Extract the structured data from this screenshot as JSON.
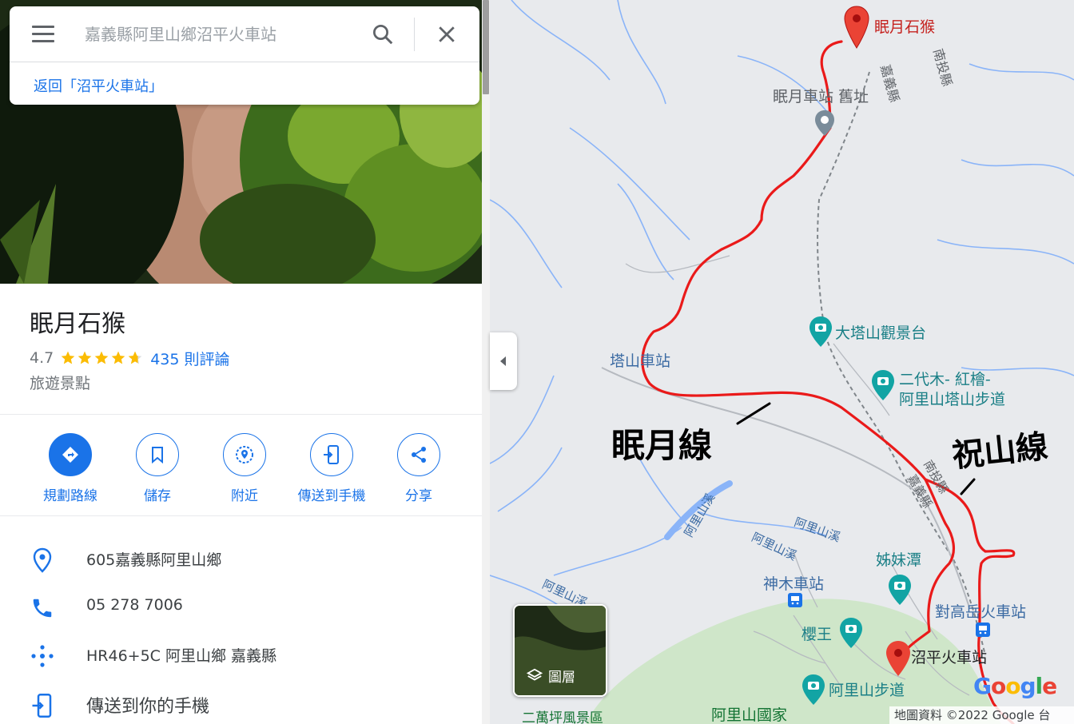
{
  "search": {
    "placeholder": "嘉義縣阿里山鄉沼平火車站",
    "back_link": "返回「沼平火車站」"
  },
  "place": {
    "title": "眠月石猴",
    "rating": "4.7",
    "rating_stars": 4.7,
    "reviews": "435 則評論",
    "category": "旅遊景點"
  },
  "actions": [
    {
      "label": "規劃路線",
      "icon": "directions-icon"
    },
    {
      "label": "儲存",
      "icon": "bookmark-icon"
    },
    {
      "label": "附近",
      "icon": "nearby-icon"
    },
    {
      "label": "傳送到手機",
      "icon": "send-to-phone-icon"
    },
    {
      "label": "分享",
      "icon": "share-icon"
    }
  ],
  "info": {
    "address": "605嘉義縣阿里山鄉",
    "phone": "05 278 7006",
    "plus_code": "HR46+5C 阿里山鄉 嘉義縣",
    "send_to_phone": "傳送到你的手機"
  },
  "map": {
    "labels": {
      "destination": "眠月石猴",
      "old_station": "眠月車站 舊址",
      "tashan_station": "塔山車站",
      "datashan": "大塔山觀景台",
      "erdaimu_1": "二代木- 紅檜-",
      "erdaimu_2": "阿里山塔山步道",
      "sisters_pond": "姊妹潭",
      "shenmu_station": "神木車站",
      "duigaoyue_station": "對高岳火車站",
      "yingwang": "櫻王",
      "zhaoping_station": "沼平火車站",
      "alishan_trail": "阿里山步道",
      "alishan_park": "阿里山國家",
      "erwanping": "二萬坪風景區",
      "chiayi_county_1": "嘉義縣",
      "nantou_county_1": "南投縣",
      "chiayi_county_2": "嘉義縣",
      "nantou_county_2": "南投縣",
      "alishan_creek_1": "阿里山溪",
      "alishan_creek_2": "阿里山溪",
      "alishan_creek_3": "阿里山溪",
      "alishan_creek_4": "阿里山溪"
    },
    "annotations": {
      "mianyue_line": "眠月線",
      "zhushan_line": "祝山線"
    },
    "layers_label": "圖層",
    "google_logo": "Google",
    "attribution": "地圖資料 ©2022 Google 台",
    "colors": {
      "route": "#ea1a1a",
      "park": "#cfe6c9",
      "water": "#8ab4f8",
      "pin": "#ea4335",
      "poi": "#1a7f86"
    }
  }
}
